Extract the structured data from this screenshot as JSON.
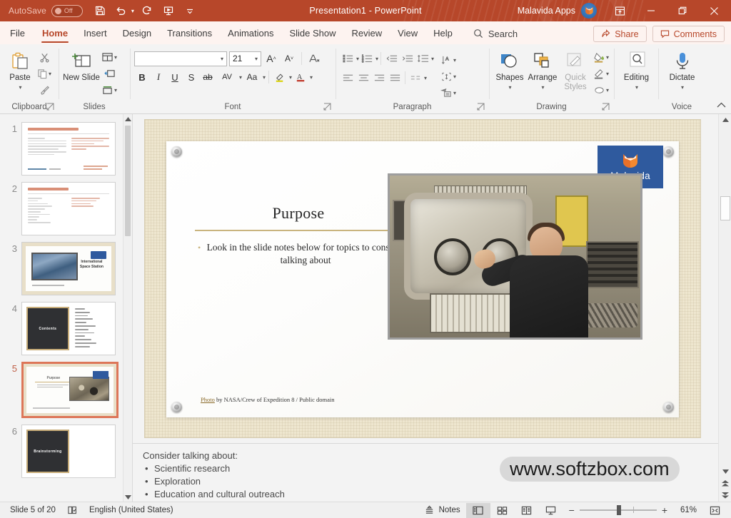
{
  "titlebar": {
    "autosave_label": "AutoSave",
    "autosave_state": "Off",
    "document_title": "Presentation1  -  PowerPoint",
    "account_name": "Malavida Apps",
    "quick_access": [
      "save-icon",
      "undo-icon",
      "redo-icon",
      "start-presentation-icon",
      "customize-qat-icon"
    ],
    "window_controls": [
      "ribbon-display-options",
      "minimize",
      "restore",
      "close"
    ]
  },
  "tabs": [
    {
      "label": "File",
      "active": false
    },
    {
      "label": "Home",
      "active": true
    },
    {
      "label": "Insert",
      "active": false
    },
    {
      "label": "Design",
      "active": false
    },
    {
      "label": "Transitions",
      "active": false
    },
    {
      "label": "Animations",
      "active": false
    },
    {
      "label": "Slide Show",
      "active": false
    },
    {
      "label": "Review",
      "active": false
    },
    {
      "label": "View",
      "active": false
    },
    {
      "label": "Help",
      "active": false
    }
  ],
  "search": {
    "label": "Search",
    "placeholder": "Search"
  },
  "share": {
    "label": "Share"
  },
  "comments": {
    "label": "Comments"
  },
  "ribbon": {
    "clipboard": {
      "name": "Clipboard",
      "paste_label": "Paste",
      "cut": "Cut",
      "copy": "Copy",
      "format_painter": "Format Painter"
    },
    "slides": {
      "name": "Slides",
      "new_slide_label": "New Slide",
      "layout": "Layout",
      "reset": "Reset",
      "section": "Section"
    },
    "font": {
      "name": "Font",
      "font_name_value": "",
      "font_name_placeholder": "",
      "font_size_value": "21",
      "bold": "B",
      "italic": "I",
      "underline": "U",
      "shadow": "S",
      "strikethrough": "ab",
      "spacing": "AV",
      "case": "Aa",
      "grow": "A",
      "shrink": "A",
      "clear_formatting": "A"
    },
    "paragraph": {
      "name": "Paragraph"
    },
    "drawing": {
      "name": "Drawing",
      "shapes_label": "Shapes",
      "arrange_label": "Arrange",
      "quick_styles_label": "Quick Styles"
    },
    "editing": {
      "name": "",
      "label": "Editing"
    },
    "voice": {
      "name": "Voice",
      "label": "Dictate"
    }
  },
  "thumbnails": [
    {
      "number": "1",
      "selected": false,
      "kind": "outline",
      "title": "Here's your outline to get started"
    },
    {
      "number": "2",
      "selected": false,
      "kind": "outline2",
      "title": "Related topics to research"
    },
    {
      "number": "3",
      "selected": false,
      "kind": "iss",
      "title": "International Space Station"
    },
    {
      "number": "4",
      "selected": false,
      "kind": "dark",
      "title": "Contents"
    },
    {
      "number": "5",
      "selected": true,
      "kind": "slide5",
      "title": "Purpose"
    },
    {
      "number": "6",
      "selected": false,
      "kind": "dark",
      "title": "Brainstorming"
    }
  ],
  "slide": {
    "title": "Purpose",
    "bullet": "Look in the slide notes below for topics to consider talking about",
    "credit_link": "Photo",
    "credit_rest": " by NASA/Crew of Expedition 8 / Public domain",
    "logo_text": "Malavida",
    "photo_alt": "astronaut-at-microgravity-science-glovebox"
  },
  "notes": {
    "heading": "Consider talking about:",
    "items": [
      "Scientific research",
      "Exploration",
      "Education and cultural outreach"
    ]
  },
  "watermark": {
    "text": "www.softzbox.com"
  },
  "status": {
    "slide_counter": "Slide 5 of 20",
    "language": "English (United States)",
    "notes_label": "Notes",
    "views": [
      "normal-view",
      "slide-sorter-view",
      "reading-view",
      "slide-show-view"
    ],
    "zoom_percent": "61%",
    "zoom_out": "−",
    "zoom_in": "+",
    "fit_label": "fit-slide-to-window"
  },
  "colors": {
    "brand": "#b7472a",
    "tab_strip": "#fdf3f0",
    "ribbon": "#f3f3f3",
    "selection": "#dd7658",
    "logo_blue": "#2f5a9e",
    "slide_mat": "#eee6cf",
    "accent_rule": "#c9b47e"
  }
}
